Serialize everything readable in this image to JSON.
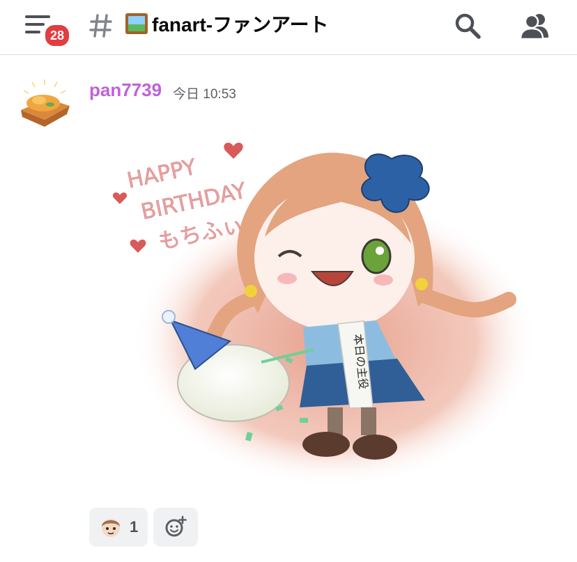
{
  "header": {
    "menu_icon": "hamburger-menu-icon",
    "badge_count": "28",
    "channel_icon": "hash-icon",
    "channel_emoji": "framed-picture-emoji",
    "channel_name": "fanart-ファンアート",
    "search_icon": "search-icon",
    "members_icon": "members-icon"
  },
  "message": {
    "username": "pan7739",
    "username_color": "#c061d9",
    "timestamp": "今日 10:53",
    "avatar_icon": "bread-avatar",
    "artwork": {
      "text_lines": [
        "HAPPY",
        "BIRTHDAY",
        "もちふぃ"
      ],
      "sash_text": "本日の主役"
    }
  },
  "reactions": [
    {
      "emoji_icon": "custom-character-emoji",
      "count": "1"
    }
  ],
  "add_reaction_icon": "add-reaction-icon",
  "colors": {
    "badge": "#e23d3f",
    "icon_gray": "#4e5058",
    "reaction_bg": "#f0f1f3"
  }
}
